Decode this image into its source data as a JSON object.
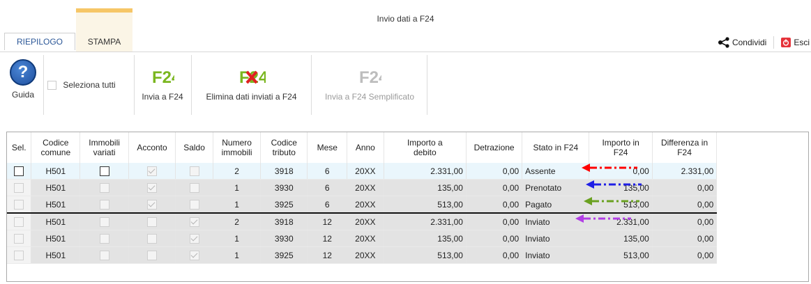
{
  "window": {
    "title": "Invio dati a F24"
  },
  "tabs": [
    {
      "label": "RIEPILOGO"
    },
    {
      "label": "STAMPA"
    }
  ],
  "actions": {
    "share_label": "Condividi",
    "exit_label": "Esci"
  },
  "ribbon": {
    "guida_label": "Guida",
    "select_all_label": "Seleziona tutti",
    "invia_label": "Invia a F24",
    "elimina_label": "Elimina dati inviati a F24",
    "semplificato_label": "Invia a F24 Semplificato",
    "f24_icon_text": "F24"
  },
  "table": {
    "headers": {
      "sel": "Sel.",
      "codice_comune": [
        "Codice",
        "comune"
      ],
      "immobili_variati": [
        "Immobili",
        "variati"
      ],
      "acconto": "Acconto",
      "saldo": "Saldo",
      "numero_immobili": [
        "Numero",
        "immobili"
      ],
      "codice_tributo": [
        "Codice",
        "tributo"
      ],
      "mese": "Mese",
      "anno": "Anno",
      "importo_debito": [
        "Importo a",
        "debito"
      ],
      "detrazione": "Detrazione",
      "stato": "Stato in F24",
      "importo_in_f24": [
        "Importo in",
        "F24"
      ],
      "differenza": [
        "Differenza in",
        "F24"
      ]
    },
    "rows": [
      {
        "comune": "H501",
        "numero": "2",
        "tributo": "3918",
        "mese": "6",
        "anno": "20XX",
        "importo": "2.331,00",
        "detrazione": "0,00",
        "stato": "Assente",
        "importo_f24": "0,00",
        "differenza": "2.331,00"
      },
      {
        "comune": "H501",
        "numero": "1",
        "tributo": "3930",
        "mese": "6",
        "anno": "20XX",
        "importo": "135,00",
        "detrazione": "0,00",
        "stato": "Prenotato",
        "importo_f24": "135,00",
        "differenza": "0,00"
      },
      {
        "comune": "H501",
        "numero": "1",
        "tributo": "3925",
        "mese": "6",
        "anno": "20XX",
        "importo": "513,00",
        "detrazione": "0,00",
        "stato": "Pagato",
        "importo_f24": "513,00",
        "differenza": "0,00"
      },
      {
        "comune": "H501",
        "numero": "2",
        "tributo": "3918",
        "mese": "12",
        "anno": "20XX",
        "importo": "2.331,00",
        "detrazione": "0,00",
        "stato": "Inviato",
        "importo_f24": "2.331,00",
        "differenza": "0,00"
      },
      {
        "comune": "H501",
        "numero": "1",
        "tributo": "3930",
        "mese": "12",
        "anno": "20XX",
        "importo": "135,00",
        "detrazione": "0,00",
        "stato": "Inviato",
        "importo_f24": "135,00",
        "differenza": "0,00"
      },
      {
        "comune": "H501",
        "numero": "1",
        "tributo": "3925",
        "mese": "12",
        "anno": "20XX",
        "importo": "513,00",
        "detrazione": "0,00",
        "stato": "Inviato",
        "importo_f24": "513,00",
        "differenza": "0,00"
      }
    ]
  },
  "annotations": {
    "arrow_colors": [
      "#ff0000",
      "#1f1fe6",
      "#6aa120",
      "#b23ee6"
    ]
  },
  "colors": {
    "accent_tab": "#f6c667",
    "f24_green": "#7ab61f",
    "delete_red": "#e02020",
    "tab_text": "#2b5797"
  }
}
